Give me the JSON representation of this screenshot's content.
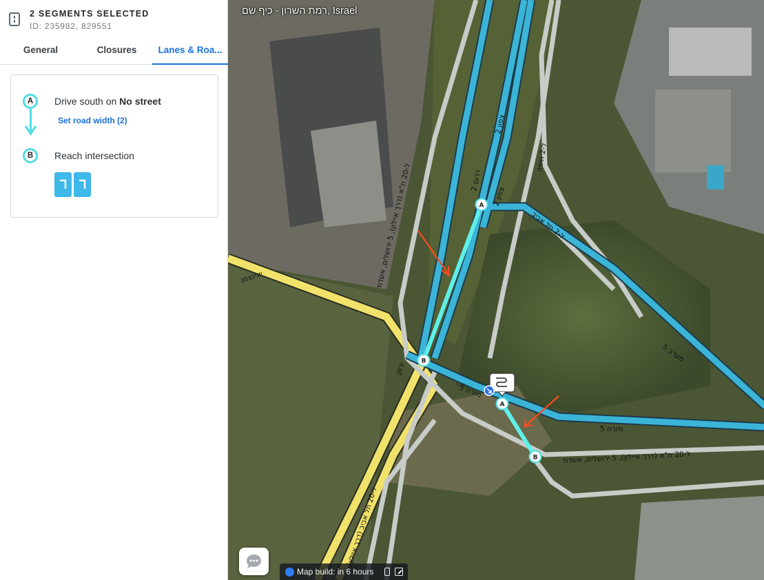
{
  "header": {
    "title": "2 SEGMENTS SELECTED",
    "ids": "ID: 235982, 829551",
    "icon": "segment-icon"
  },
  "tabs": [
    {
      "label": "General",
      "active": false
    },
    {
      "label": "Closures",
      "active": false
    },
    {
      "label": "Lanes & Roa...",
      "active": true
    }
  ],
  "lanes_card": {
    "node_a": "A",
    "node_b": "B",
    "step_a_prefix": "Drive south on ",
    "step_a_street": "No street",
    "set_width_link": "Set road width (2)",
    "step_b": "Reach intersection",
    "lane_count": 2,
    "lane_icon": "turn-left-arrow-icon"
  },
  "map": {
    "location": "רמת השרון - כיף שם, Israel",
    "build_status": "Map build: in 6 hours",
    "road_labels": [
      "יונינצמן",
      "ל-20 ת\"א (דרך איילון), 5 ירושלים, אשדוד",
      "5 מזרח",
      "5 מזרח",
      "2 צפון",
      "2 דרום",
      "2 צפון",
      "ל-2 תל אביב",
      "ל-2 חיפה",
      "5 מערב",
      "ל-20 ת\"א (דרך איילון), 5 ירושלים, אשדוד",
      "ל-20 תל אביב (דרך איילון), 5",
      "5 מזרח",
      "ירמן",
      "ל-20 ת\"א (דרך איילון)"
    ],
    "markers": [
      "A",
      "B",
      "A",
      "B"
    ],
    "colors": {
      "freeway": "#3bb4d8",
      "selected": "#5ff0e8",
      "major": "#f1e26b",
      "ramp": "#c7ccc8",
      "annotation": "#ff4a1a"
    }
  }
}
